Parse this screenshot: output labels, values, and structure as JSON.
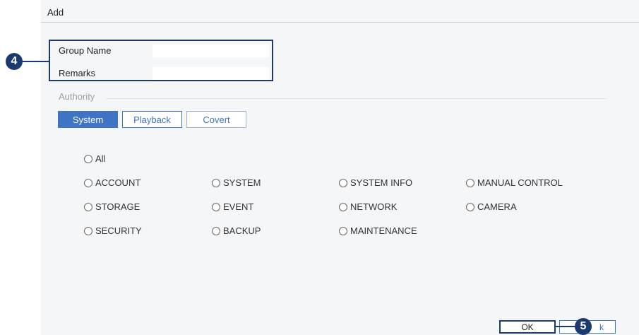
{
  "dialog": {
    "title": "Add"
  },
  "form": {
    "group_name_label": "Group Name",
    "group_name_value": "",
    "remarks_label": "Remarks",
    "remarks_value": ""
  },
  "authority": {
    "label": "Authority",
    "tabs": [
      {
        "label": "System",
        "active": true
      },
      {
        "label": "Playback",
        "active": false
      },
      {
        "label": "Covert",
        "active": false
      }
    ],
    "options": {
      "all": "All",
      "account": "ACCOUNT",
      "system": "SYSTEM",
      "system_info": "SYSTEM INFO",
      "manual_control": "MANUAL CONTROL",
      "storage": "STORAGE",
      "event": "EVENT",
      "network": "NETWORK",
      "camera": "CAMERA",
      "security": "SECURITY",
      "backup": "BACKUP",
      "maintenance": "MAINTENANCE"
    }
  },
  "callouts": {
    "step4": "4",
    "step5": "5"
  },
  "buttons": {
    "ok": "OK",
    "back_partial": "k"
  },
  "colors": {
    "accent": "#3f74c4",
    "callout": "#1d3a6e"
  }
}
